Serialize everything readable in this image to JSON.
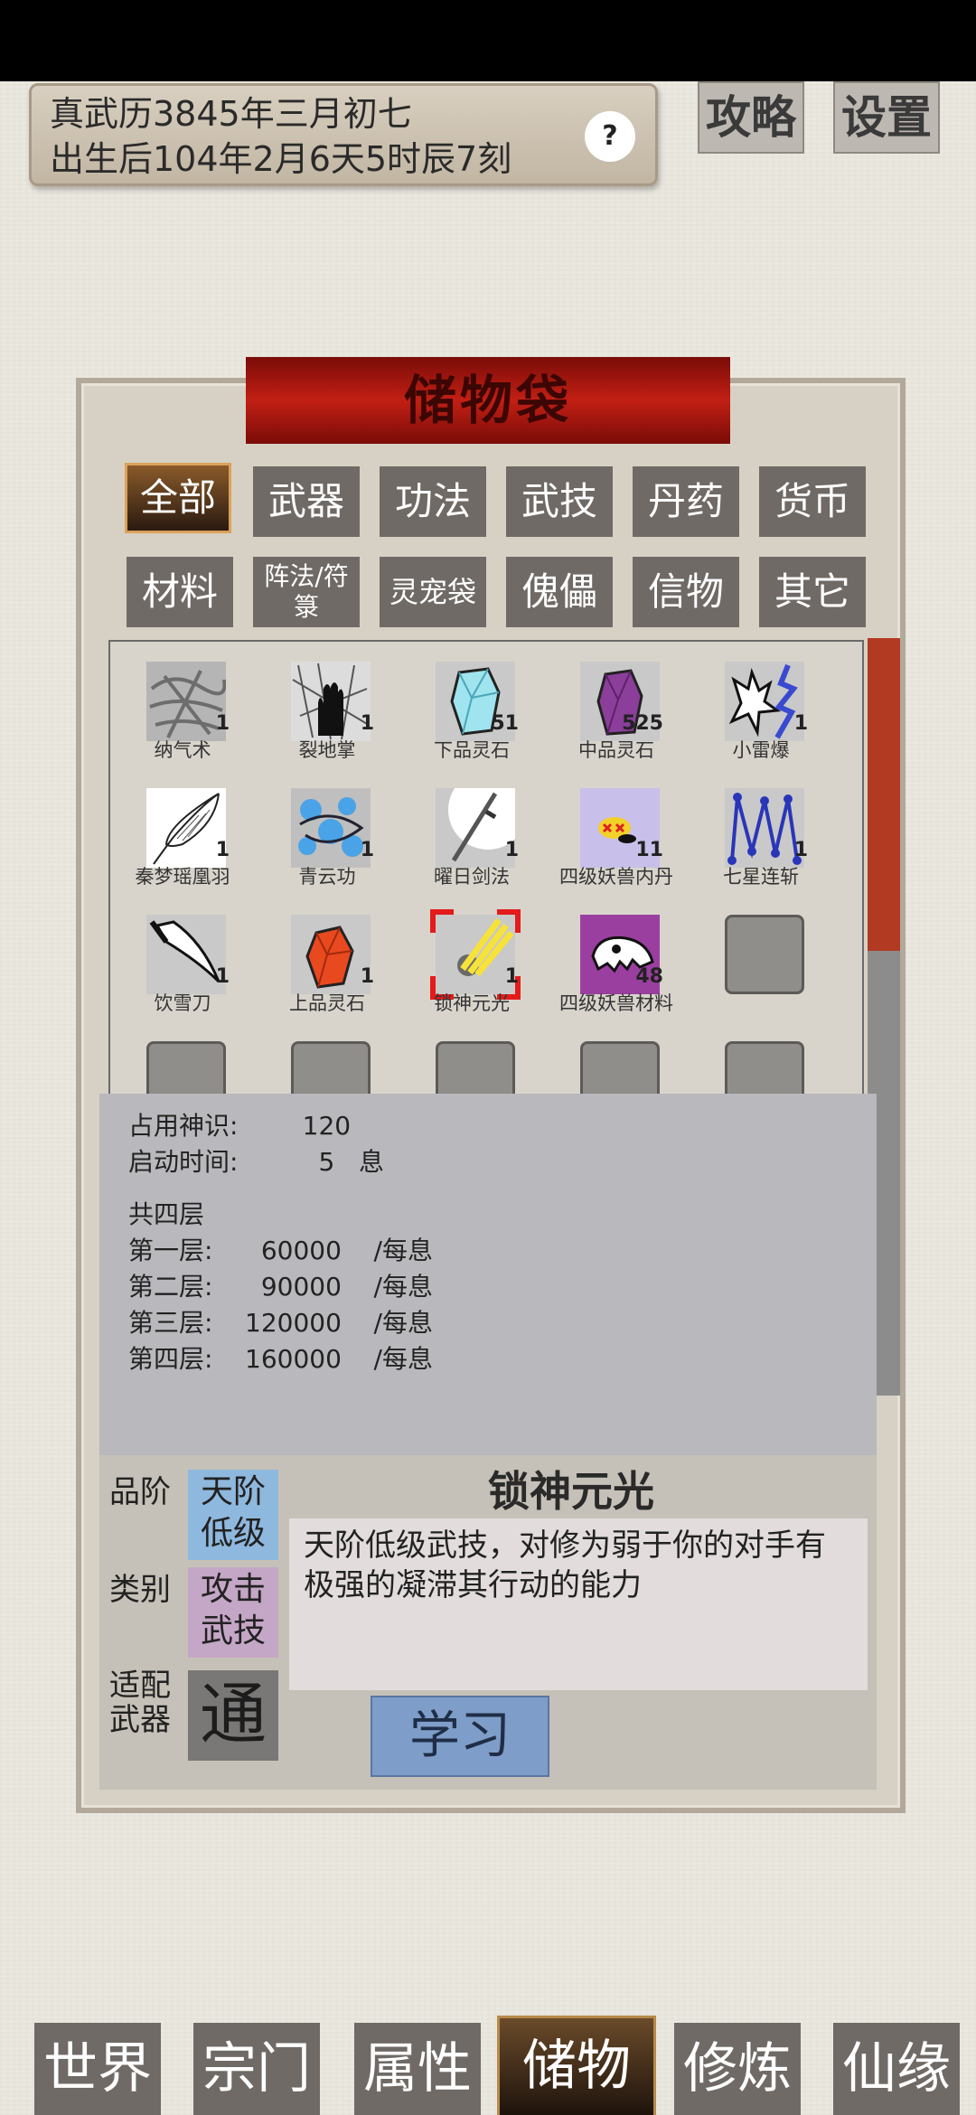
{
  "status_bar": {},
  "header": {
    "date_line1": "真武历3845年三月初七",
    "date_line2": "出生后104年2月6天5时辰7刻",
    "help_label": "?",
    "guide_label": "攻略",
    "settings_label": "设置"
  },
  "bag": {
    "title": "储物袋",
    "tabs_row1": [
      "全部",
      "武器",
      "功法",
      "武技",
      "丹药",
      "货币"
    ],
    "tabs_row2": [
      "材料",
      "阵法/符箓",
      "灵宠袋",
      "傀儡",
      "信物",
      "其它"
    ],
    "active_tab": "全部"
  },
  "items": [
    {
      "name": "纳气术",
      "count": "1",
      "icon": "scroll-gray-icon"
    },
    {
      "name": "裂地掌",
      "count": "1",
      "icon": "palm-icon"
    },
    {
      "name": "下品灵石",
      "count": "51",
      "icon": "blue-crystal-icon"
    },
    {
      "name": "中品灵石",
      "count": "525",
      "icon": "purple-crystal-icon"
    },
    {
      "name": "小雷爆",
      "count": "1",
      "icon": "thunder-icon"
    },
    {
      "name": "秦梦瑶凰羽",
      "count": "1",
      "icon": "feather-icon"
    },
    {
      "name": "青云功",
      "count": "1",
      "icon": "blue-cloud-icon"
    },
    {
      "name": "曜日剑法",
      "count": "1",
      "icon": "sun-sword-icon"
    },
    {
      "name": "四级妖兽内丹",
      "count": "11",
      "icon": "beast-core-icon"
    },
    {
      "name": "七星连斩",
      "count": "1",
      "icon": "seven-stars-icon"
    },
    {
      "name": "饮雪刀",
      "count": "1",
      "icon": "saber-icon"
    },
    {
      "name": "上品灵石",
      "count": "1",
      "icon": "red-crystal-icon"
    },
    {
      "name": "锁神元光",
      "count": "1",
      "icon": "golden-light-icon"
    },
    {
      "name": "四级妖兽材料",
      "count": "48",
      "icon": "beast-skull-icon"
    }
  ],
  "detail": {
    "row1": "占用神识:        120",
    "row2": "启动时间:          5   息",
    "row3": "共四层",
    "row4": "第一层:      60000    /每息",
    "row5": "第二层:      90000    /每息",
    "row6": "第三层:    120000    /每息",
    "row7": "第四层:    160000    /每息"
  },
  "info": {
    "grade_label": "品阶",
    "grade_value": "天阶低级",
    "type_label": "类别",
    "type_value": "攻击武技",
    "weapon_label": "适配武器",
    "weapon_value": "通",
    "item_name": "锁神元光",
    "description": "天阶低级武技，对修为弱于你的对手有极强的凝滞其行动的能力",
    "learn_label": "学习",
    "colors": {
      "grade_bg": "#8fb8de",
      "type_bg": "#c4a6c6",
      "weapon_bg": "#7a7876"
    }
  },
  "nav": [
    "世界",
    "宗门",
    "属性",
    "储物",
    "修炼",
    "仙缘"
  ],
  "nav_active": "储物"
}
